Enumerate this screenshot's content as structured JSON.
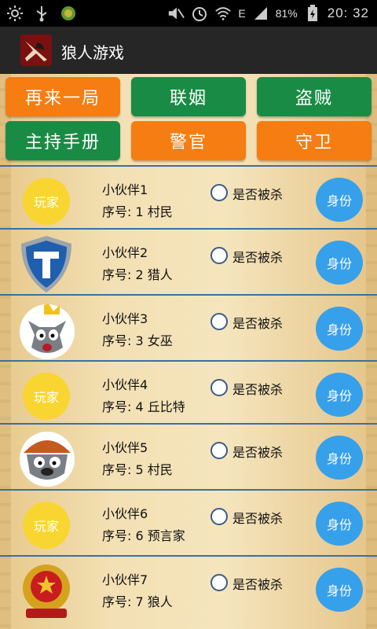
{
  "status_bar": {
    "left_icons": [
      "sun-icon",
      "usb-icon",
      "android-debug-icon"
    ],
    "network_label": "E",
    "battery": "81%",
    "time": "20: 32"
  },
  "app": {
    "title": "狼人游戏",
    "icon": "werewolf-app-icon"
  },
  "actions": [
    {
      "label": "再来一局",
      "color": "#f57d11"
    },
    {
      "label": "联姻",
      "color": "#1a8b45"
    },
    {
      "label": "盗贼",
      "color": "#1a8b45"
    },
    {
      "label": "主持手册",
      "color": "#1a8b45"
    },
    {
      "label": "警官",
      "color": "#f57d11"
    },
    {
      "label": "守卫",
      "color": "#f57d11"
    }
  ],
  "players": [
    {
      "name": "小伙伴1",
      "number_line": "序号: 1  村民",
      "avatar": "player-placeholder",
      "avatar_text": "玩家",
      "killed_label": "是否被杀",
      "identity_label": "身份"
    },
    {
      "name": "小伙伴2",
      "number_line": "序号: 2  猎人",
      "avatar": "shield-t-avatar",
      "killed_label": "是否被杀",
      "identity_label": "身份"
    },
    {
      "name": "小伙伴3",
      "number_line": "序号: 3  女巫",
      "avatar": "gray-wolf-crown-avatar",
      "killed_label": "是否被杀",
      "identity_label": "身份"
    },
    {
      "name": "小伙伴4",
      "number_line": "序号: 4  丘比特",
      "avatar": "player-placeholder",
      "avatar_text": "玩家",
      "killed_label": "是否被杀",
      "identity_label": "身份"
    },
    {
      "name": "小伙伴5",
      "number_line": "序号: 5  村民",
      "avatar": "gray-wolf-hat-avatar",
      "killed_label": "是否被杀",
      "identity_label": "身份"
    },
    {
      "name": "小伙伴6",
      "number_line": "序号: 6  预言家",
      "avatar": "player-placeholder",
      "avatar_text": "玩家",
      "killed_label": "是否被杀",
      "identity_label": "身份"
    },
    {
      "name": "小伙伴7",
      "number_line": "序号: 7  狼人",
      "avatar": "police-badge-avatar",
      "killed_label": "是否被杀",
      "identity_label": "身份"
    }
  ]
}
